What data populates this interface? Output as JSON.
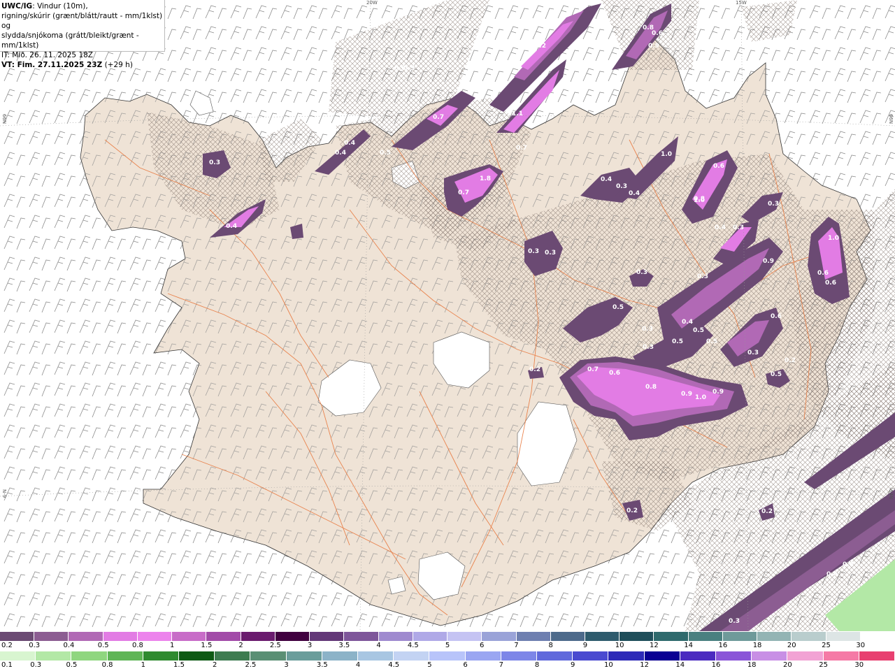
{
  "title": {
    "model": "UWC/IG",
    "line1_rest": ": Vindur (10m),",
    "line2": "rigning/skúrir (grænt/blátt/rautt - mm/1klst) og",
    "line3": "slydda/snjókoma (grátt/bleikt/grænt - mm/1klst)",
    "line4": "IT: Mið. 26. 11. 2025 18Z",
    "line5": "VT: Fim. 27.11.2025 23Z",
    "line5_offset": " (+29 h)"
  },
  "grid_labels": {
    "top_20w": "20W",
    "top_15w": "15W",
    "left_66n": "66N",
    "right_66n": "66N",
    "left_9": "N-9",
    "right_64": "64N"
  },
  "precip_values": [
    "1.2",
    "0.8",
    "0.6",
    "0.9",
    "0.3",
    "0.6",
    "1.1",
    "0.4",
    "0.4",
    "0.3",
    "0.7",
    "1.8",
    "0.7",
    "0.5",
    "0.7",
    "0.4",
    "0.3",
    "0.4",
    "1.0",
    "0.8",
    "0.6",
    "0.3",
    "0.3",
    "0.4",
    "0.4",
    "0.3",
    "0.3",
    "0.9",
    "1.0",
    "0.3",
    "1.0",
    "0.6",
    "0.6",
    "0.5",
    "0.3",
    "0.4",
    "0.5",
    "0.3",
    "0.5",
    "0.5",
    "0.6",
    "0.3",
    "0.3",
    "0.2",
    "0.7",
    "0.6",
    "0.8",
    "0.9",
    "1.0",
    "0.9",
    "0.5",
    "0.2",
    "0.2",
    "0.2",
    "0.4",
    "0.4",
    "0.3"
  ],
  "legend_snow": {
    "labels": [
      "0.2",
      "0.3",
      "0.4",
      "0.5",
      "0.8",
      "1",
      "1.5",
      "2",
      "2.5",
      "3",
      "3.5",
      "4",
      "4.5",
      "5",
      "6",
      "7",
      "8",
      "9",
      "10",
      "12",
      "14",
      "16",
      "18",
      "20",
      "25",
      "30"
    ],
    "colors": [
      "#6b4a73",
      "#8c5d92",
      "#b169b5",
      "#e27ce4",
      "#ec83ec",
      "#c86cc8",
      "#a24ba8",
      "#6a1b6e",
      "#40003f",
      "#633878",
      "#7e569a",
      "#9f8acf",
      "#b0a9e7",
      "#c5c3f3",
      "#9aa3d8",
      "#6e7fb0",
      "#4d6a8b",
      "#2e5b6d",
      "#1f4e5a",
      "#2f6a6d",
      "#4a8080",
      "#6f9a9a",
      "#93b4b4",
      "#b9cdcd",
      "#dde5e5",
      "#ffffff"
    ]
  },
  "legend_rain": {
    "labels": [
      "0.1",
      "0.3",
      "0.5",
      "0.8",
      "1",
      "1.5",
      "2",
      "2.5",
      "3",
      "3.5",
      "4",
      "4.5",
      "5",
      "6",
      "7",
      "8",
      "9",
      "10",
      "12",
      "14",
      "16",
      "18",
      "20",
      "25",
      "30"
    ],
    "colors": [
      "#d8f5d0",
      "#b3e8a6",
      "#8fd67f",
      "#5fb556",
      "#2f8a2f",
      "#0e5a14",
      "#3e7c50",
      "#5a8f74",
      "#6a9d9b",
      "#8cb3c8",
      "#a8c6e2",
      "#c3d3f3",
      "#b8c4fa",
      "#9aa6f2",
      "#7d86e8",
      "#6069dc",
      "#4a4ad0",
      "#2d2ab8",
      "#0a0093",
      "#4b2bc0",
      "#8a55d8",
      "#c88fe5",
      "#f2a3d4",
      "#f57aa6",
      "#e84070"
    ]
  },
  "colors": {
    "land": "#efe3d6",
    "sea": "#ffffff",
    "roads": "#e8793f",
    "wind_barbs": "#8c8c8c",
    "hatch": "#7d6f66",
    "snow_light": "#6b4a73",
    "snow_mid": "#b169b5",
    "snow_heavy": "#e27ce4",
    "rain_light": "#b3e8a6"
  }
}
